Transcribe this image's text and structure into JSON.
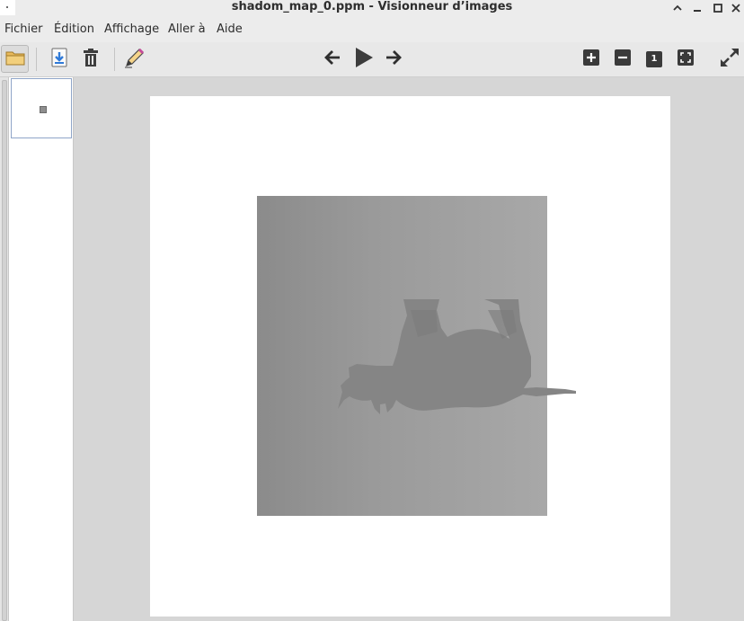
{
  "window": {
    "title": "shadom_map_0.ppm - Visionneur d’images",
    "controls": [
      "chevron-up-icon",
      "minimize-icon",
      "maximize-icon",
      "close-icon"
    ]
  },
  "menu": {
    "items": [
      {
        "label": "Fichier"
      },
      {
        "label": "Édition"
      },
      {
        "label": "Affichage"
      },
      {
        "label": "Aller à"
      },
      {
        "label": "Aide"
      }
    ]
  },
  "toolbar": {
    "icons": [
      "folder-icon",
      "save-icon",
      "trash-icon",
      "edit-icon",
      "arrow-left-icon",
      "play-icon",
      "arrow-right-icon",
      "zoom-in-icon",
      "zoom-out-icon",
      "zoom-original-icon",
      "zoom-fit-icon",
      "fullscreen-icon"
    ],
    "zoom_original_label": "1"
  },
  "colors": {
    "accent": "#3a7ad0",
    "thumb_border": "#8fa5c8"
  }
}
